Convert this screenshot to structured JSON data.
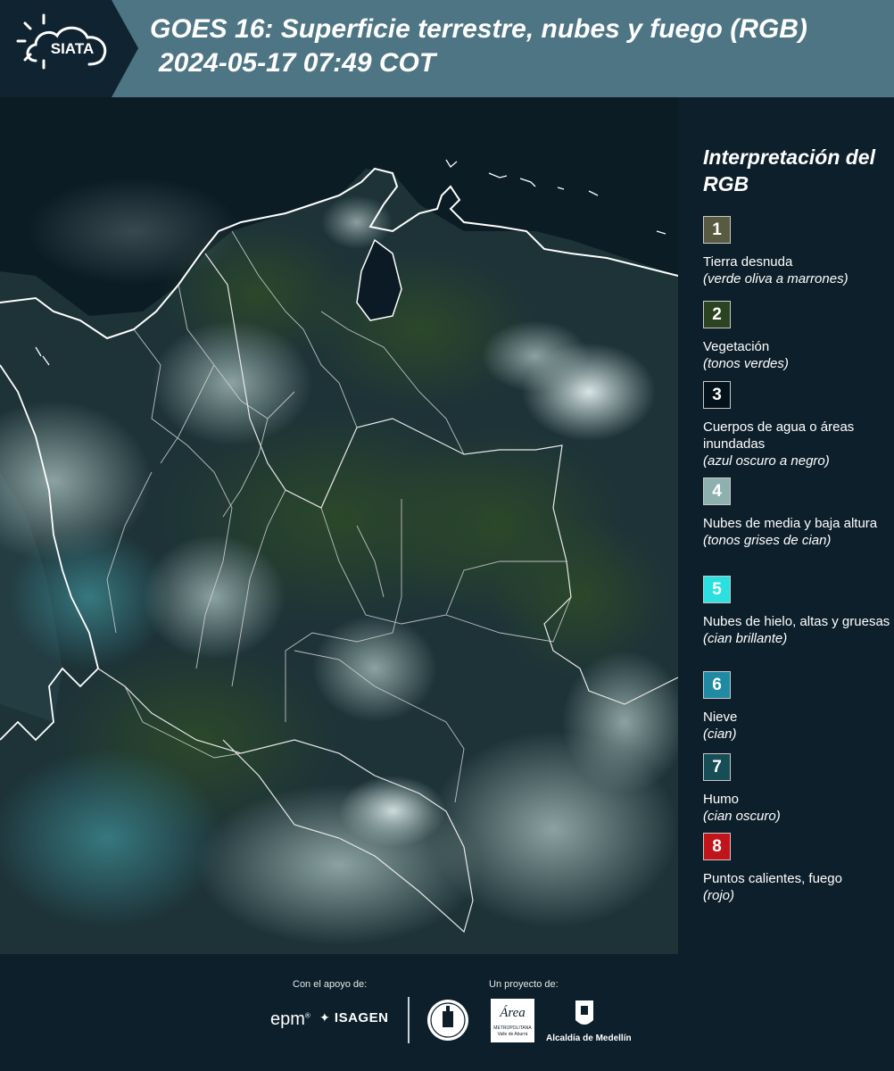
{
  "header": {
    "logo_text": "SIATA",
    "title_line1": "GOES 16: Superficie terrestre, nubes y fuego (RGB)",
    "title_line2": "2024-05-17 07:49 COT"
  },
  "map": {
    "icon": "satellite-map-image"
  },
  "legend": {
    "title": "Interpretación del RGB",
    "items": [
      {
        "number": "1",
        "label": "Tierra desnuda",
        "desc": "(verde oliva a marrones)",
        "color": "#585b42"
      },
      {
        "number": "2",
        "label": "Vegetación",
        "desc": "(tonos verdes)",
        "color": "#2b4321"
      },
      {
        "number": "3",
        "label": "Cuerpos de agua o áreas inundadas",
        "desc": "(azul oscuro a negro)",
        "color": "#06121b"
      },
      {
        "number": "4",
        "label": "Nubes de media y baja altura",
        "desc": "(tonos grises de cian)",
        "color": "#8eb0ae"
      },
      {
        "number": "5",
        "label": "Nubes de hielo, altas y gruesas",
        "desc": "(cian brillante)",
        "color": "#2de0e0"
      },
      {
        "number": "6",
        "label": "Nieve",
        "desc": "(cian)",
        "color": "#208aa3"
      },
      {
        "number": "7",
        "label": "Humo",
        "desc": "(cian oscuro)",
        "color": "#174d55"
      },
      {
        "number": "8",
        "label": "Puntos calientes, fuego",
        "desc": "(rojo)",
        "color": "#c0161b"
      }
    ]
  },
  "footer": {
    "support_label": "Con el apoyo de:",
    "project_label": "Un proyecto de:",
    "epm": "epm",
    "isagen": "ISAGEN",
    "area_name": "Área",
    "area_sub": "METROPOLITANA",
    "area_sub2": "Valle de Aburrá",
    "alcaldia": "Alcaldía de Medellín"
  }
}
